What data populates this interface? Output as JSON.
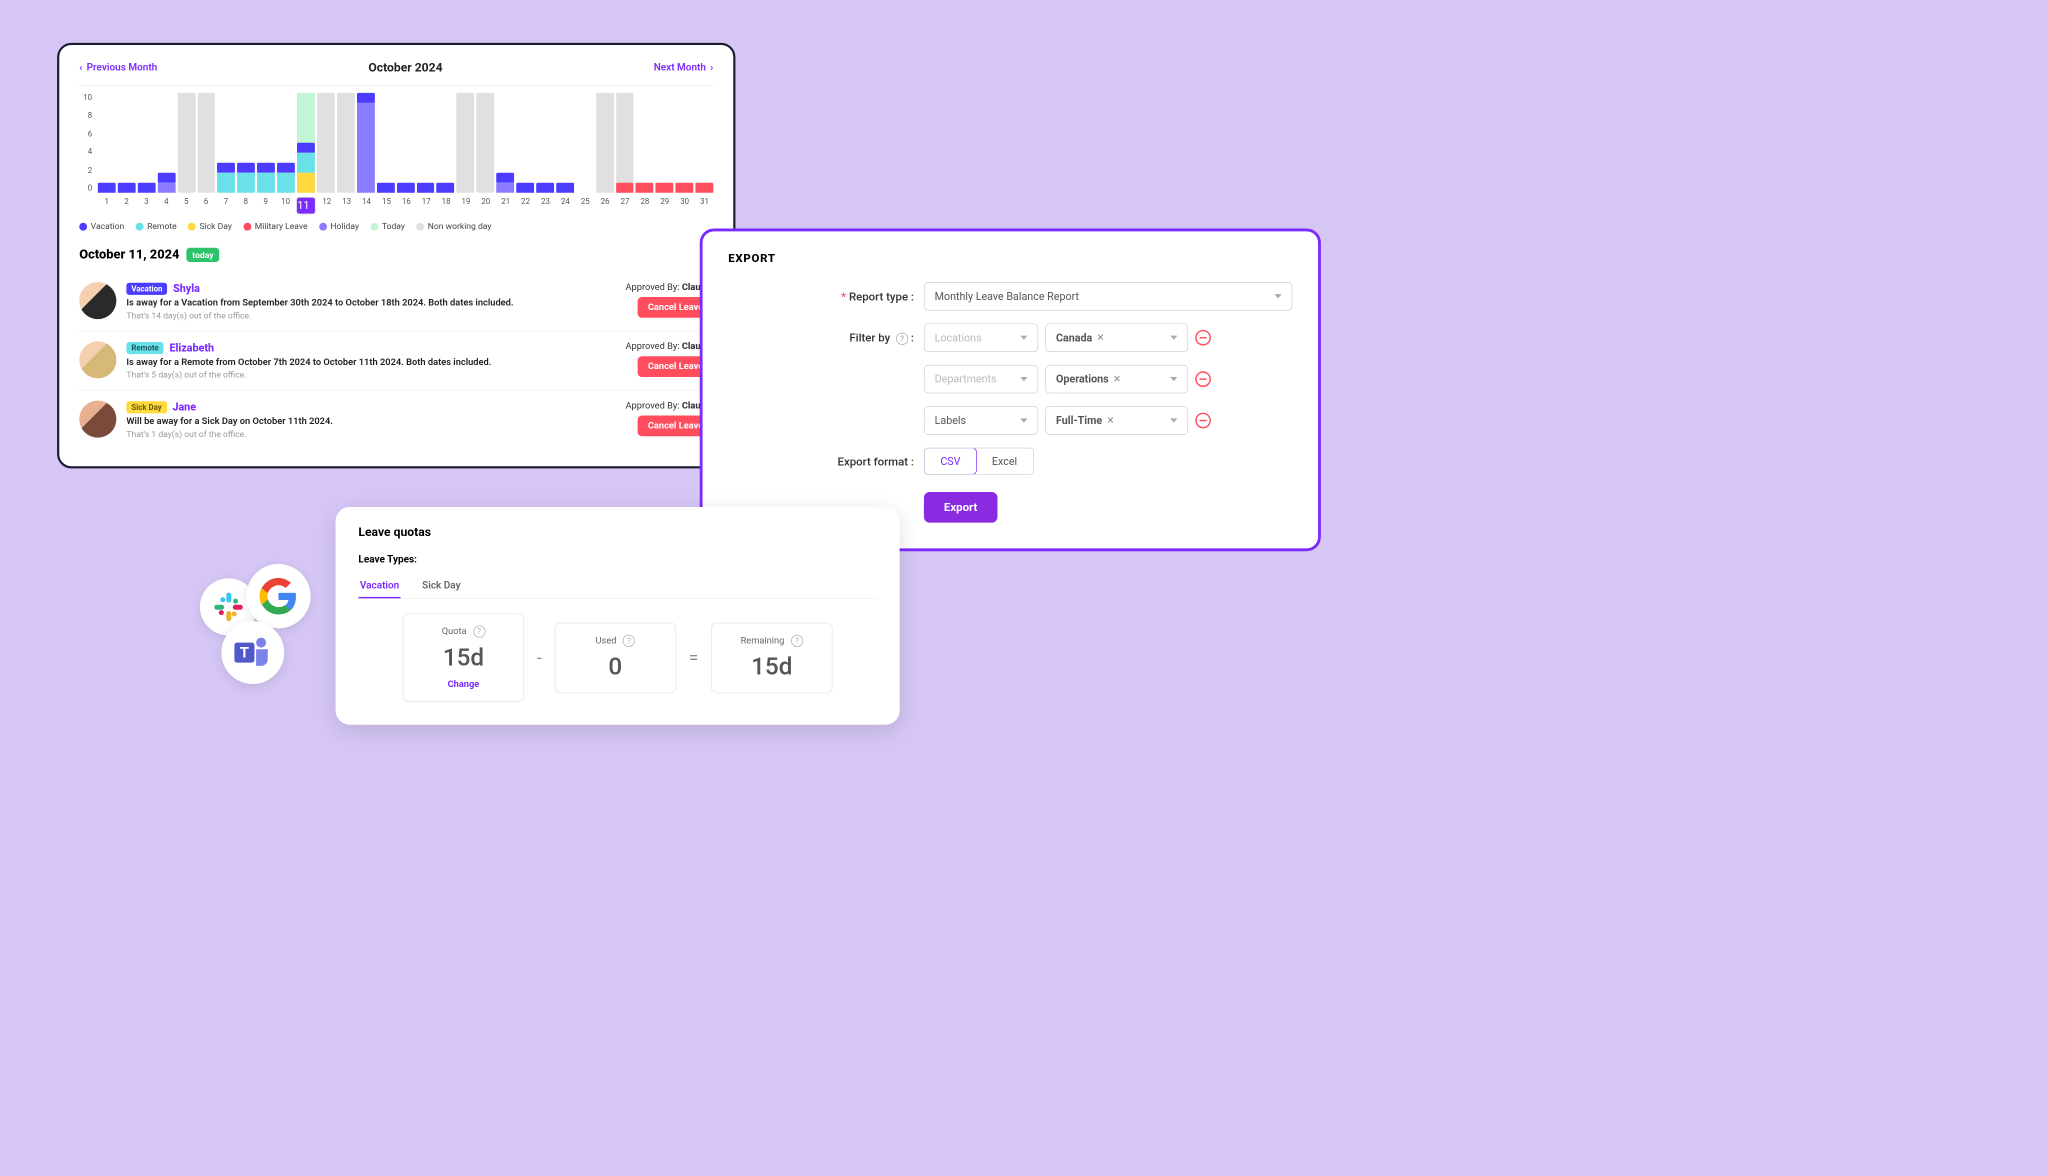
{
  "calendar": {
    "prev": "Previous Month",
    "next": "Next Month",
    "title": "October 2024",
    "y_ticks": [
      "10",
      "8",
      "6",
      "4",
      "2",
      "0"
    ],
    "days": [
      1,
      2,
      3,
      4,
      5,
      6,
      7,
      8,
      9,
      10,
      11,
      12,
      13,
      14,
      15,
      16,
      17,
      18,
      19,
      20,
      21,
      22,
      23,
      24,
      25,
      26,
      27,
      28,
      29,
      30,
      31
    ],
    "selected_day": 11,
    "legend": [
      {
        "label": "Vacation",
        "color": "#4b3cff"
      },
      {
        "label": "Remote",
        "color": "#6ae1e8"
      },
      {
        "label": "Sick Day",
        "color": "#ffd93f"
      },
      {
        "label": "Military Leave",
        "color": "#ff4d5e"
      },
      {
        "label": "Holiday",
        "color": "#8a7bff"
      },
      {
        "label": "Today",
        "color": "#c1f5d4"
      },
      {
        "label": "Non working day",
        "color": "#e0e0e0"
      }
    ],
    "date_heading": "October 11, 2024",
    "today_badge": "today",
    "leaves": [
      {
        "tag": "Vacation",
        "tag_class": "tag-vac",
        "name": "Shyla",
        "desc": "Is away for a Vacation from September 30th 2024 to October 18th 2024. Both dates included.",
        "sub": "That's 14 day(s) out of the office.",
        "approver": "Claudia",
        "avatar": "av1"
      },
      {
        "tag": "Remote",
        "tag_class": "tag-rem",
        "name": "Elizabeth",
        "desc": "Is away for a Remote from October 7th 2024 to October 11th 2024. Both dates included.",
        "sub": "That's 5 day(s) out of the office.",
        "approver": "Claudia",
        "avatar": "av2"
      },
      {
        "tag": "Sick Day",
        "tag_class": "tag-sick",
        "name": "Jane",
        "desc": "Will be away for a Sick Day on October 11th 2024.",
        "sub": "That's 1 day(s) out of the office.",
        "approver": "Claudia",
        "avatar": "av3"
      }
    ],
    "approved_by_label": "Approved By:",
    "cancel_label": "Cancel Leave"
  },
  "chart_data": {
    "type": "bar",
    "title": "October 2024",
    "ylim": [
      0,
      10
    ],
    "categories": [
      1,
      2,
      3,
      4,
      5,
      6,
      7,
      8,
      9,
      10,
      11,
      12,
      13,
      14,
      15,
      16,
      17,
      18,
      19,
      20,
      21,
      22,
      23,
      24,
      25,
      26,
      27,
      28,
      29,
      30,
      31
    ],
    "non_working_days": [
      5,
      6,
      12,
      13,
      19,
      20,
      26,
      27
    ],
    "today": 11,
    "series": [
      {
        "name": "Vacation",
        "color": "#4b3cff",
        "values": [
          1,
          1,
          1,
          1,
          0,
          0,
          1,
          1,
          1,
          1,
          1,
          0,
          0,
          1,
          1,
          1,
          1,
          1,
          0,
          0,
          1,
          1,
          1,
          1,
          0,
          0,
          0,
          0,
          0,
          0,
          0
        ]
      },
      {
        "name": "Remote",
        "color": "#6ae1e8",
        "values": [
          0,
          0,
          0,
          0,
          0,
          0,
          2,
          2,
          2,
          2,
          2,
          0,
          0,
          0,
          0,
          0,
          0,
          0,
          0,
          0,
          0,
          0,
          0,
          0,
          0,
          0,
          0,
          0,
          0,
          0,
          0
        ]
      },
      {
        "name": "Sick Day",
        "color": "#ffd93f",
        "values": [
          0,
          0,
          0,
          0,
          0,
          0,
          0,
          0,
          0,
          0,
          2,
          0,
          0,
          0,
          0,
          0,
          0,
          0,
          0,
          0,
          0,
          0,
          0,
          0,
          0,
          0,
          0,
          0,
          0,
          0,
          0
        ]
      },
      {
        "name": "Military Leave",
        "color": "#ff4d5e",
        "values": [
          0,
          0,
          0,
          0,
          0,
          0,
          0,
          0,
          0,
          0,
          0,
          0,
          0,
          0,
          0,
          0,
          0,
          0,
          0,
          0,
          0,
          0,
          0,
          0,
          0,
          0,
          1,
          1,
          1,
          1,
          1
        ]
      },
      {
        "name": "Holiday",
        "color": "#8a7bff",
        "values": [
          0,
          0,
          0,
          1,
          0,
          0,
          0,
          0,
          0,
          0,
          0,
          0,
          0,
          9,
          0,
          0,
          0,
          0,
          0,
          0,
          1,
          0,
          0,
          0,
          0,
          0,
          0,
          0,
          0,
          0,
          0
        ]
      }
    ]
  },
  "export": {
    "title": "EXPORT",
    "report_type_label": "Report type :",
    "report_type_value": "Monthly Leave Balance Report",
    "filter_by_label": "Filter by",
    "filters": [
      {
        "left": "Locations",
        "left_disabled": true,
        "val": "Canada"
      },
      {
        "left": "Departments",
        "left_disabled": true,
        "val": "Operations"
      },
      {
        "left": "Labels",
        "left_disabled": false,
        "val": "Full-Time"
      }
    ],
    "format_label": "Export format :",
    "formats": [
      "CSV",
      "Excel"
    ],
    "format_active": "CSV",
    "button": "Export"
  },
  "quotas": {
    "title": "Leave quotas",
    "sub": "Leave Types:",
    "tabs": [
      "Vacation",
      "Sick Day"
    ],
    "active_tab": "Vacation",
    "quota_label": "Quota",
    "quota_val": "15d",
    "used_label": "Used",
    "used_val": "0",
    "remain_label": "Remaining",
    "remain_val": "15d",
    "change": "Change"
  }
}
